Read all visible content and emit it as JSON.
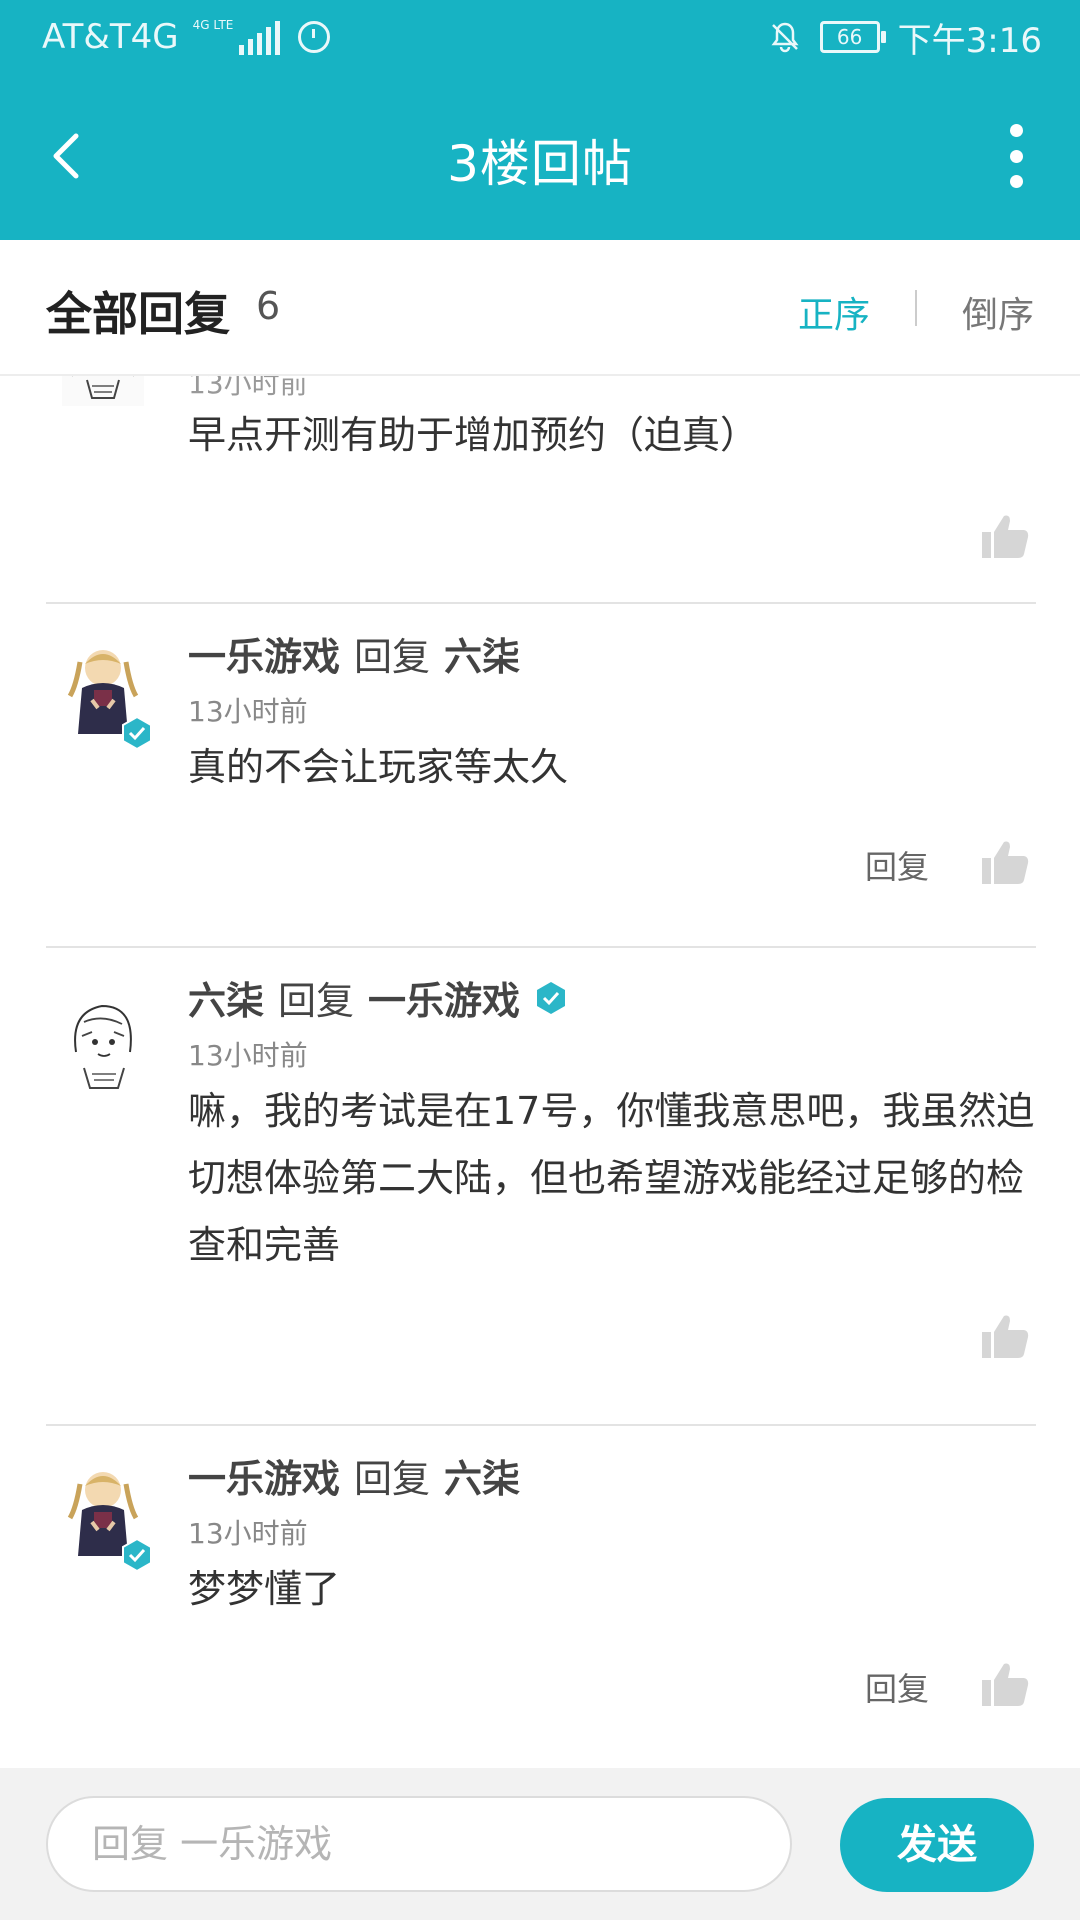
{
  "status_bar": {
    "carrier": "AT&T4G",
    "network_tag": "4G LTE",
    "battery": "66",
    "time": "下午3:16"
  },
  "header": {
    "title": "3楼回帖"
  },
  "replies_header": {
    "title": "全部回复",
    "count": "6",
    "sort_asc": "正序",
    "sort_desc": "倒序"
  },
  "comments": [
    {
      "time": "13小时前",
      "body": "早点开测有助于增加预约（迫真）"
    },
    {
      "author": "一乐游戏",
      "reply_word": "回复",
      "target": "六柒",
      "time": "13小时前",
      "body": "真的不会让玩家等太久",
      "reply_label": "回复"
    },
    {
      "author": "六柒",
      "reply_word": "回复",
      "target": "一乐游戏",
      "time": "13小时前",
      "body": "嘛，我的考试是在17号，你懂我意思吧，我虽然迫切想体验第二大陆，但也希望游戏能经过足够的检查和完善"
    },
    {
      "author": "一乐游戏",
      "reply_word": "回复",
      "target": "六柒",
      "time": "13小时前",
      "body": "梦梦懂了",
      "reply_label": "回复"
    }
  ],
  "composer": {
    "placeholder": "回复 一乐游戏",
    "send_label": "发送"
  },
  "colors": {
    "accent": "#17b3c3",
    "badge": "#2bb6c8"
  }
}
